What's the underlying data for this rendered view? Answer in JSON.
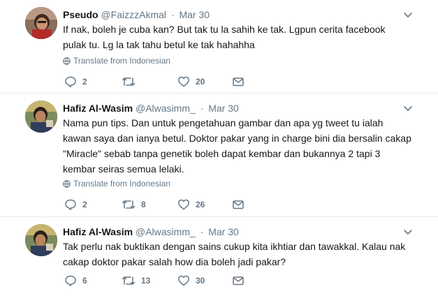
{
  "colors": {
    "text": "#14171a",
    "muted": "#657786",
    "divider": "#e6ecf0"
  },
  "tweets": [
    {
      "name": "Pseudo",
      "handle": "@FaizzzAkmal",
      "separator": "·",
      "date": "Mar 30",
      "text": "If nak, boleh je cuba kan? But tak tu la sahih ke tak. Lgpun cerita facebook\npulak tu. Lg la tak tahu betul ke tak hahahha",
      "translate": "Translate from Indonesian",
      "reply_count": "2",
      "retweet_count": "",
      "like_count": "20"
    },
    {
      "name": "Hafiz Al-Wasim",
      "handle": "@Alwasimm_",
      "separator": "·",
      "date": "Mar 30",
      "text": "Nama pun tips. Dan untuk pengetahuan gambar dan apa yg tweet tu ialah\nkawan saya dan ianya betul. Doktor pakar yang in charge bini dia bersalin cakap\n\"Miracle\" sebab tanpa genetik boleh dapat kembar dan bukannya 2 tapi 3\nkembar seiras semua lelaki.",
      "translate": "Translate from Indonesian",
      "reply_count": "2",
      "retweet_count": "8",
      "like_count": "26"
    },
    {
      "name": "Hafiz Al-Wasim",
      "handle": "@Alwasimm_",
      "separator": "·",
      "date": "Mar 30",
      "text": "Tak perlu nak buktikan dengan sains cukup kita ikhtiar dan tawakkal. Kalau nak\ncakap doktor pakar salah how dia boleh jadi pakar?",
      "translate": "",
      "reply_count": "6",
      "retweet_count": "13",
      "like_count": "30"
    }
  ]
}
